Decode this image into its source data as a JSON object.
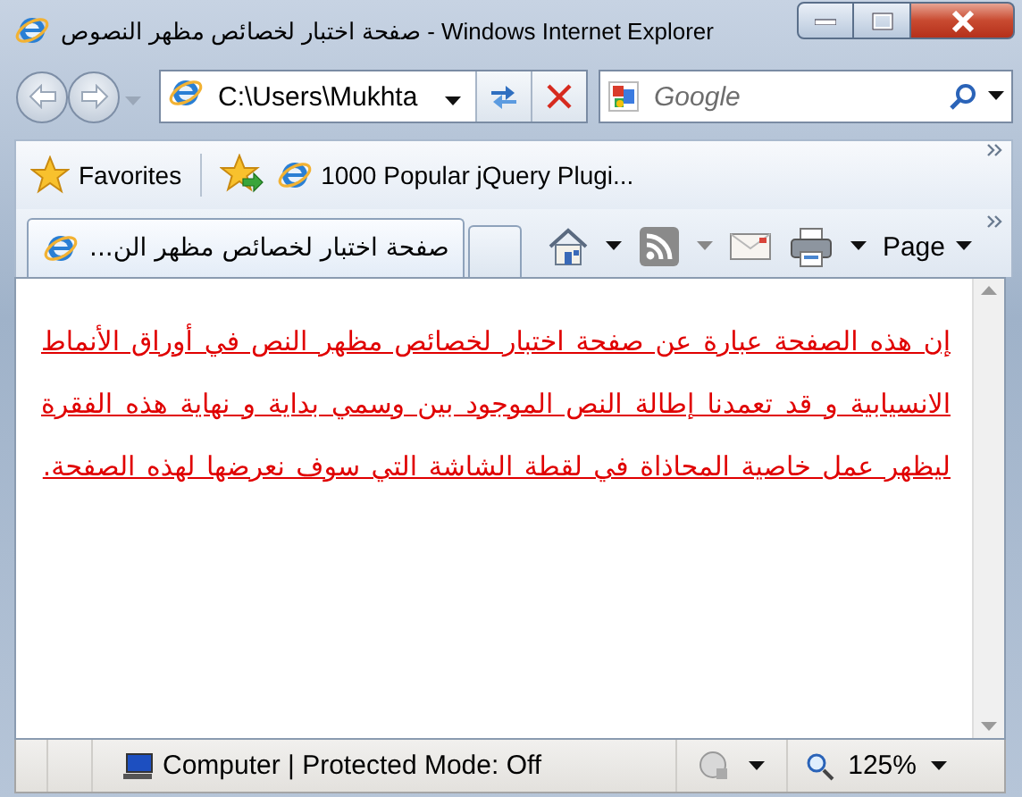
{
  "window": {
    "title": "صفحة اختبار لخصائص مظهر النصوص - Windows Internet Explorer"
  },
  "address_bar": {
    "value": "C:\\Users\\Mukhta"
  },
  "search": {
    "placeholder": "Google"
  },
  "favorites_bar": {
    "label": "Favorites",
    "links": [
      {
        "label": "1000 Popular jQuery Plugi..."
      }
    ]
  },
  "tabs": [
    {
      "label": "صفحة اختبار لخصائص مظهر الن...",
      "selected": true
    }
  ],
  "command_bar": {
    "page_menu": "Page"
  },
  "content": {
    "paragraph": "إن هذه الصفحة عبارة عن صفحة اختبار لخصائص مظهر النص في أوراق الأنماط الانسيابية و قد تعمدنا إطالة النص الموجود بين وسمي بداية و نهاية هذه الفقرة ليظهر عمل خاصية المحاذاة في لقطة الشاشة التي سوف نعرضها لهذه الصفحة."
  },
  "status_bar": {
    "zone": "Computer | Protected Mode: Off",
    "zoom": "125%"
  }
}
